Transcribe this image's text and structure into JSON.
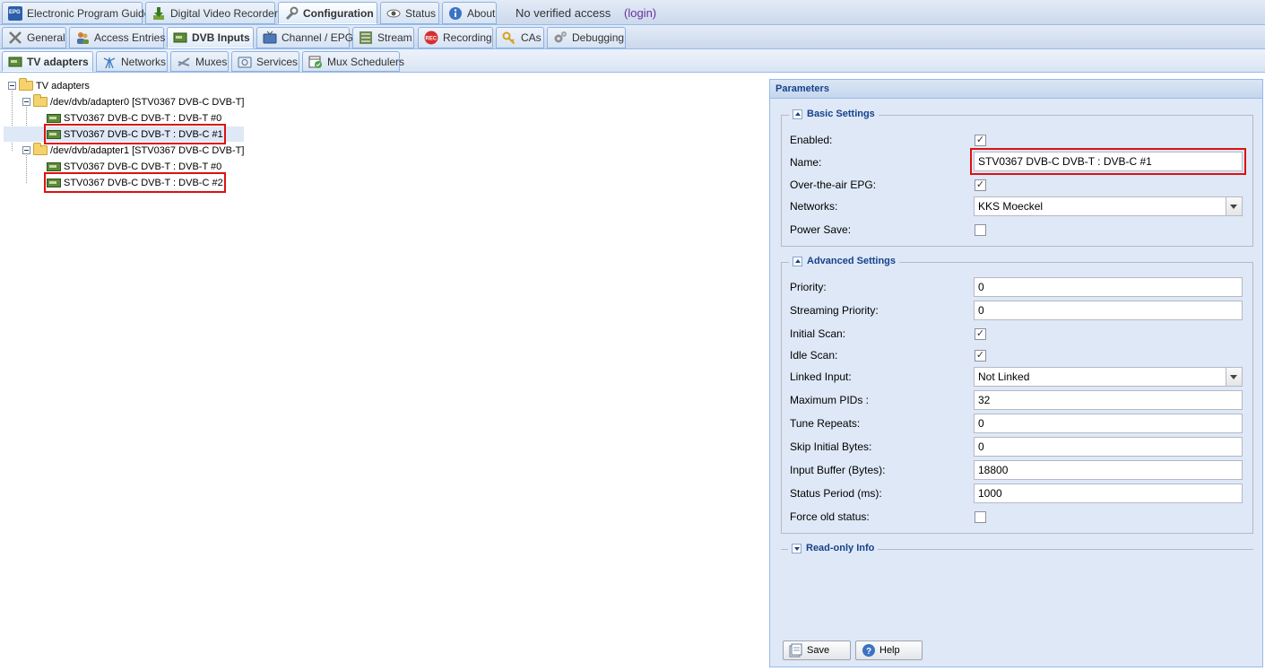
{
  "top_tabs": [
    {
      "label": "Electronic Program Guide",
      "icon": "epg-icon"
    },
    {
      "label": "Digital Video Recorder",
      "icon": "download-icon"
    },
    {
      "label": "Configuration",
      "icon": "wrench-icon",
      "active": true
    },
    {
      "label": "Status",
      "icon": "eye-icon"
    },
    {
      "label": "About",
      "icon": "info-icon"
    }
  ],
  "access": {
    "text": "No verified access",
    "login": "(login)"
  },
  "config_tabs": [
    {
      "label": "General",
      "icon": "tools-icon"
    },
    {
      "label": "Access Entries",
      "icon": "users-icon"
    },
    {
      "label": "DVB Inputs",
      "icon": "tv-card-icon",
      "active": true
    },
    {
      "label": "Channel / EPG",
      "icon": "tv-icon"
    },
    {
      "label": "Stream",
      "icon": "stream-icon"
    },
    {
      "label": "Recording",
      "icon": "rec-icon"
    },
    {
      "label": "CAs",
      "icon": "key-icon"
    },
    {
      "label": "Debugging",
      "icon": "gears-icon"
    }
  ],
  "dvb_tabs": [
    {
      "label": "TV adapters",
      "icon": "tv-card-icon",
      "active": true
    },
    {
      "label": "Networks",
      "icon": "antenna-icon"
    },
    {
      "label": "Muxes",
      "icon": "muxes-icon"
    },
    {
      "label": "Services",
      "icon": "services-icon"
    },
    {
      "label": "Mux Schedulers",
      "icon": "scheduler-icon"
    }
  ],
  "tree": {
    "root": "TV adapters",
    "adapter0": {
      "label": "/dev/dvb/adapter0 [STV0367 DVB-C DVB-T]",
      "frontends": [
        "STV0367 DVB-C DVB-T : DVB-T #0",
        "STV0367 DVB-C DVB-T : DVB-C #1"
      ]
    },
    "adapter1": {
      "label": "/dev/dvb/adapter1 [STV0367 DVB-C DVB-T]",
      "frontends": [
        "STV0367 DVB-C DVB-T : DVB-T #0",
        "STV0367 DVB-C DVB-T : DVB-C #2"
      ]
    }
  },
  "panel": {
    "title": "Parameters",
    "basic": {
      "legend": "Basic Settings",
      "enabled_label": "Enabled:",
      "enabled": true,
      "name_label": "Name:",
      "name_value": "STV0367 DVB-C DVB-T : DVB-C #1",
      "ota_label": "Over-the-air EPG:",
      "ota": true,
      "networks_label": "Networks:",
      "networks_value": "KKS Moeckel",
      "powersave_label": "Power Save:",
      "powersave": false
    },
    "advanced": {
      "legend": "Advanced Settings",
      "priority_label": "Priority:",
      "priority": "0",
      "streaming_priority_label": "Streaming Priority:",
      "streaming_priority": "0",
      "initial_scan_label": "Initial Scan:",
      "initial_scan": true,
      "idle_scan_label": "Idle Scan:",
      "idle_scan": true,
      "linked_input_label": "Linked Input:",
      "linked_input": "Not Linked",
      "max_pids_label": "Maximum PIDs :",
      "max_pids": "32",
      "tune_repeats_label": "Tune Repeats:",
      "tune_repeats": "0",
      "skip_bytes_label": "Skip Initial Bytes:",
      "skip_bytes": "0",
      "input_buffer_label": "Input Buffer (Bytes):",
      "input_buffer": "18800",
      "status_period_label": "Status Period (ms):",
      "status_period": "1000",
      "force_old_label": "Force old status:",
      "force_old": false
    },
    "readonly": {
      "legend": "Read-only Info"
    },
    "buttons": {
      "save": "Save",
      "help": "Help"
    }
  }
}
